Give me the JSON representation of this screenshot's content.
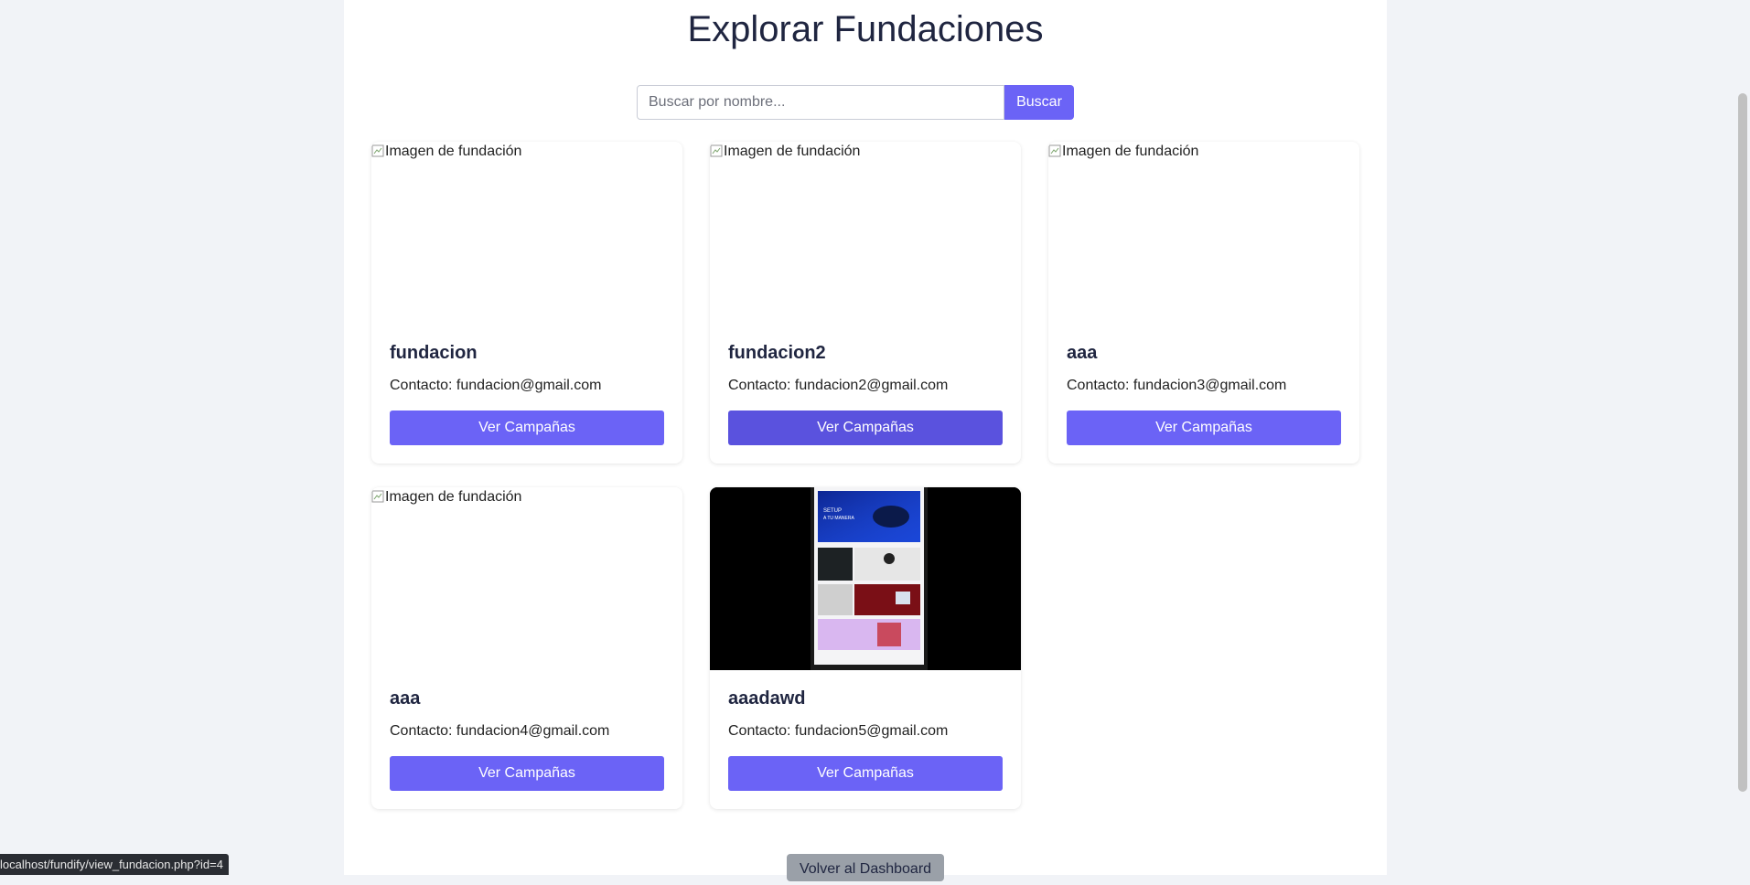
{
  "page": {
    "title": "Explorar Fundaciones"
  },
  "search": {
    "placeholder": "Buscar por nombre...",
    "value": "",
    "button_label": "Buscar"
  },
  "foundations": [
    {
      "name": "fundacion",
      "contact": "Contacto: fundacion@gmail.com",
      "image_alt": "Imagen de fundación",
      "button_label": "Ver Campañas"
    },
    {
      "name": "fundacion2",
      "contact": "Contacto: fundacion2@gmail.com",
      "image_alt": "Imagen de fundación",
      "button_label": "Ver Campañas"
    },
    {
      "name": "aaa",
      "contact": "Contacto: fundacion3@gmail.com",
      "image_alt": "Imagen de fundación",
      "button_label": "Ver Campañas"
    },
    {
      "name": "aaa",
      "contact": "Contacto: fundacion4@gmail.com",
      "image_alt": "Imagen de fundación",
      "button_label": "Ver Campañas"
    },
    {
      "name": "aaadawd",
      "contact": "Contacto: fundacion5@gmail.com",
      "image_alt": "",
      "button_label": "Ver Campañas",
      "image_text": [
        "SETUP",
        "A TU MANERA"
      ]
    }
  ],
  "footer": {
    "back_button_label": "Volver al Dashboard"
  },
  "status_bar": {
    "url": "localhost/fundify/view_fundacion.php?id=4"
  },
  "colors": {
    "accent": "#6b63f6",
    "accent_hover": "#5a52de",
    "title": "#1f2540",
    "page_background": "#f1f3f7"
  },
  "icons": {
    "broken_image": "broken-image-icon"
  }
}
